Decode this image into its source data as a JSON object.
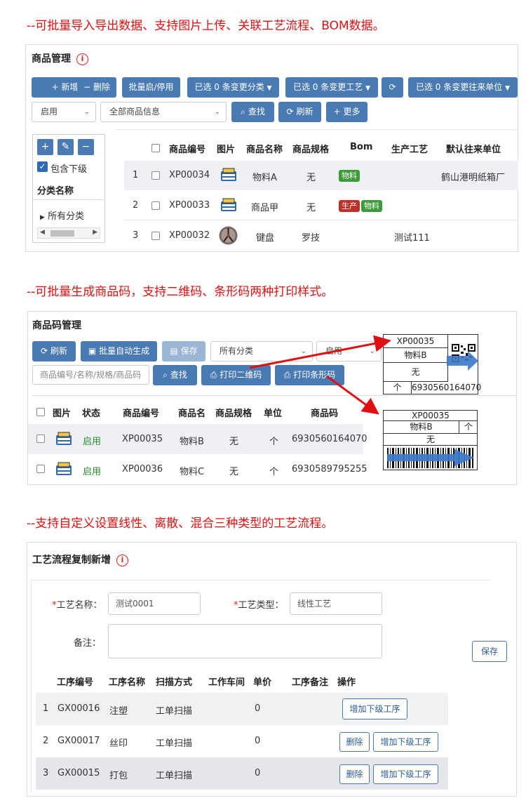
{
  "captions": {
    "c1": "--可批量导入导出数据、支持图片上传、关联工艺流程、BOM数据。",
    "c2": "--可批量生成商品码，支持二维码、条形码两种打印样式。",
    "c3": "--支持自定义设置线性、离散、混合三种类型的工艺流程。"
  },
  "product": {
    "title": "商品管理",
    "info_icon": "i",
    "toolbar": {
      "add": "新增",
      "delete": "删除",
      "batch_toggle": "批量启/停用",
      "change_category": "已选 0 条变更分类",
      "change_process": "已选 0 条变更工艺",
      "change_unit": "已选 0 条变更往来单位"
    },
    "filter": {
      "status": "启用",
      "scope": "全部商品信息",
      "search": "查找",
      "refresh": "刷新",
      "more": "更多"
    },
    "tree": {
      "include_sub": "包含下级",
      "header": "分类名称",
      "all": "所有分类"
    },
    "columns": [
      "商品编号",
      "图片",
      "商品名称",
      "商品规格",
      "Bom",
      "生产工艺",
      "默认往来单位"
    ],
    "rows": [
      {
        "idx": "1",
        "code": "XP00034",
        "name": "物料A",
        "spec": "无",
        "bom": [
          "物料"
        ],
        "process": "",
        "unit": "鹤山港明纸箱厂"
      },
      {
        "idx": "2",
        "code": "XP00033",
        "name": "商品甲",
        "spec": "无",
        "bom": [
          "生产",
          "物料"
        ],
        "process": "",
        "unit": ""
      },
      {
        "idx": "3",
        "code": "XP00032",
        "name": "键盘",
        "spec": "罗技",
        "bom": [],
        "process": "测试111",
        "unit": ""
      }
    ]
  },
  "barcode": {
    "title": "商品码管理",
    "toolbar": {
      "refresh": "刷新",
      "batch_gen": "批量自动生成",
      "save": "保存",
      "category": "所有分类",
      "status": "启用",
      "search_placeholder": "商品编号/名称/规格/商品码",
      "search": "查找",
      "print_qr": "打印二维码",
      "print_bar": "打印条形码"
    },
    "columns": [
      "图片",
      "状态",
      "商品编号",
      "商品名",
      "商品规格",
      "单位",
      "商品码"
    ],
    "rows": [
      {
        "status": "启用",
        "code": "XP00035",
        "name": "物料B",
        "spec": "无",
        "unit": "个",
        "barcode": "6930560164070"
      },
      {
        "status": "启用",
        "code": "XP00036",
        "name": "物料C",
        "spec": "无",
        "unit": "个",
        "barcode": "6930589795255"
      }
    ],
    "qr_card": {
      "code": "XP00035",
      "name": "物料B",
      "spec": "无",
      "unit": "个",
      "barcode": "6930560164070"
    },
    "bar_card": {
      "code": "XP00035",
      "name": "物料B",
      "unit": "个",
      "spec": "无"
    }
  },
  "process": {
    "title": "工艺流程复制新增",
    "form": {
      "name_label": "工艺名称：",
      "name_value": "测试0001",
      "type_label": "工艺类型：",
      "type_value": "线性工艺",
      "note_label": "备注：",
      "required_mark": "*"
    },
    "save": "保存",
    "columns": [
      "工序编号",
      "工序名称",
      "扫描方式",
      "工作车间",
      "单价",
      "工序备注",
      "操作"
    ],
    "rows": [
      {
        "idx": "1",
        "code": "GX00016",
        "name": "注塑",
        "scan": "工单扫描",
        "price": "0",
        "actions": [
          "增加下级工序"
        ]
      },
      {
        "idx": "2",
        "code": "GX00017",
        "name": "丝印",
        "scan": "工单扫描",
        "price": "0",
        "actions": [
          "删除",
          "增加下级工序"
        ]
      },
      {
        "idx": "3",
        "code": "GX00015",
        "name": "打包",
        "scan": "工单扫描",
        "price": "0",
        "actions": [
          "删除",
          "增加下级工序"
        ]
      }
    ]
  },
  "colors": {
    "accent": "#4a7ab3",
    "caption": "#e01010",
    "tag_green": "#3c9a3a",
    "tag_red": "#c0302a"
  }
}
